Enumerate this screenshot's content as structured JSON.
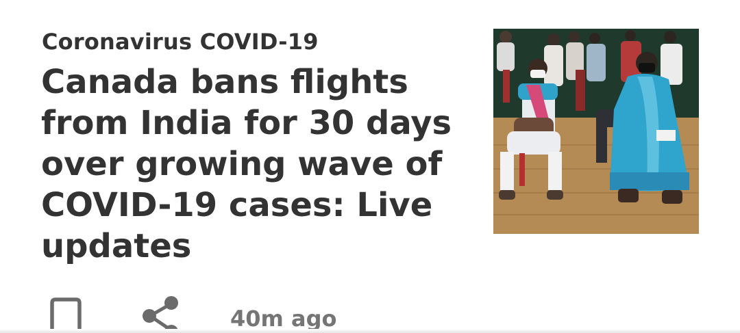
{
  "article": {
    "category": "Coronavirus COVID-19",
    "headline": "Canada bans flights from India for 30 days over growing wave of COVID-19 cases: Live updates",
    "timestamp": "40m ago",
    "thumbnail_icon": "photo-people-seated-masks"
  },
  "actions": {
    "bookmark_icon": "bookmark-icon",
    "share_icon": "share-icon"
  },
  "colors": {
    "text_primary": "#333333",
    "text_secondary": "#757575",
    "icon": "#6b6b6b"
  }
}
